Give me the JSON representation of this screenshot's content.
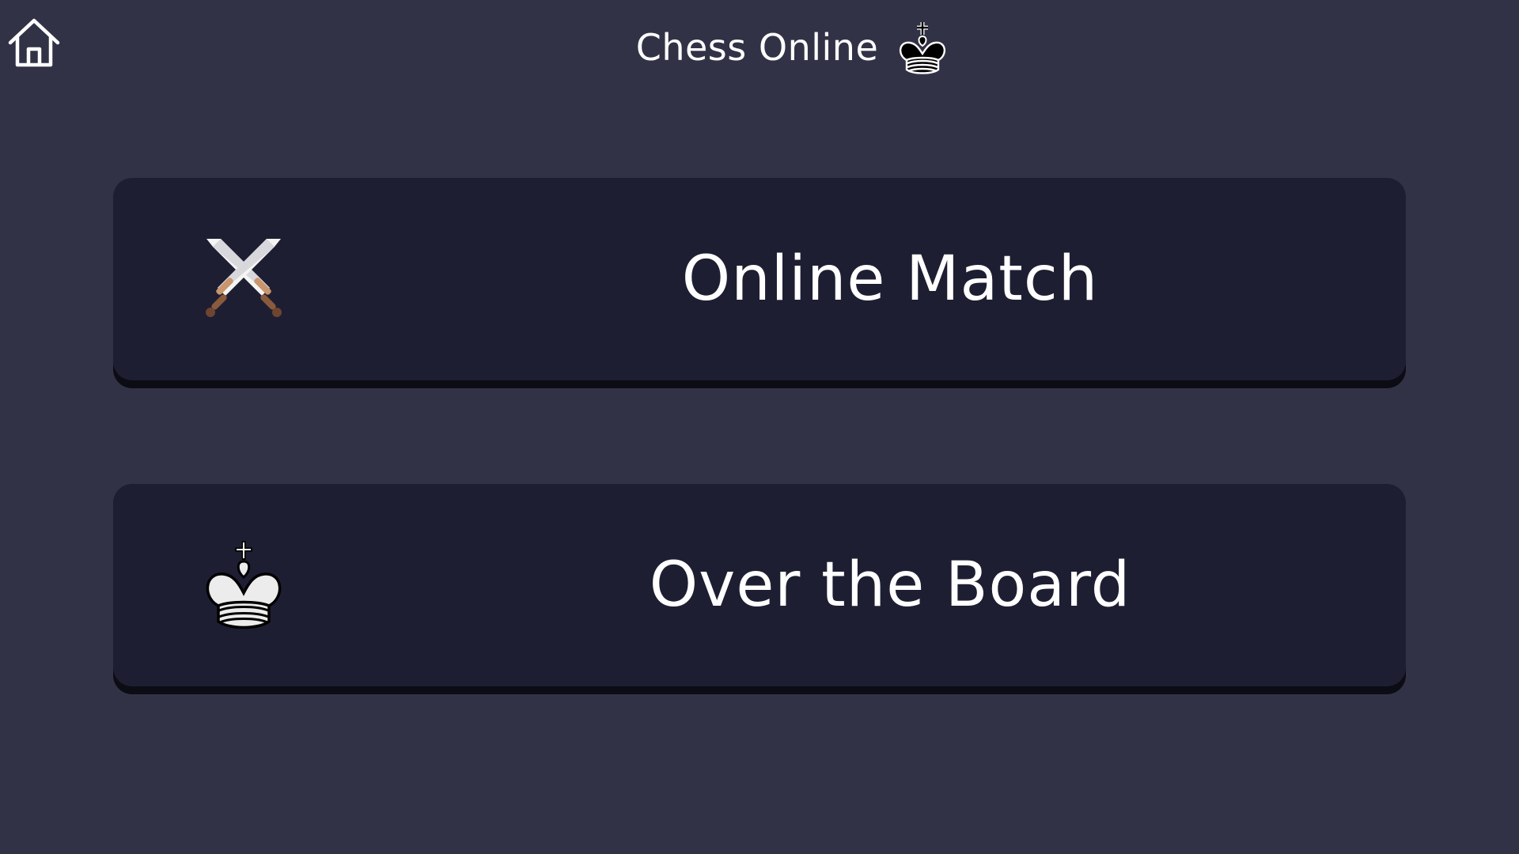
{
  "header": {
    "title": "Chess Online",
    "title_icon": "black-king-icon",
    "home_icon": "home-icon"
  },
  "menu": {
    "items": [
      {
        "label": "Online Match",
        "icon": "crossed-swords-icon"
      },
      {
        "label": "Over the Board",
        "icon": "white-king-icon"
      }
    ]
  },
  "colors": {
    "background": "#323247",
    "card": "#1e1e33",
    "card_shadow": "#0c0c14",
    "text": "#ffffff"
  }
}
